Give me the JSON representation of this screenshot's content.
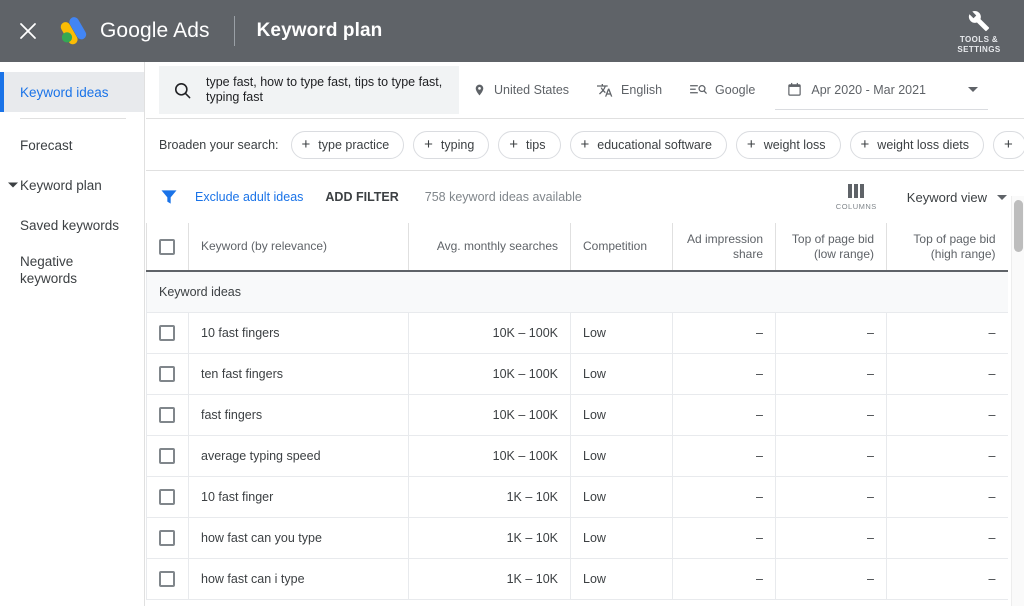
{
  "topbar": {
    "close_icon": "close-icon",
    "logo_icon": "google-ads-logo",
    "brand": "Google Ads",
    "page_title": "Keyword plan",
    "tools_icon": "wrench-icon",
    "tools_label_line1": "TOOLS &",
    "tools_label_line2": "SETTINGS",
    "bg": "#5f6368"
  },
  "sidebar": {
    "items": [
      {
        "label": "Keyword ideas",
        "active": true,
        "expandable": false
      },
      {
        "label": "Forecast",
        "active": false,
        "expandable": false
      },
      {
        "label": "Keyword plan",
        "active": false,
        "expandable": true
      },
      {
        "label": "Saved keywords",
        "active": false,
        "expandable": false
      },
      {
        "label": "Negative keywords",
        "active": false,
        "expandable": false
      }
    ],
    "accent": "#1a73e8"
  },
  "search": {
    "icon": "search-icon",
    "value": "type fast, how to type fast, tips to type fast, typing fast",
    "location_icon": "location-pin-icon",
    "location": "United States",
    "language_icon": "translate-icon",
    "language": "English",
    "network_icon": "search-network-icon",
    "network": "Google",
    "date_icon": "calendar-icon",
    "date_range": "Apr 2020 - Mar 2021",
    "date_caret": "chevron-down-icon"
  },
  "broaden": {
    "label": "Broaden your search:",
    "chips": [
      "type practice",
      "typing",
      "tips",
      "educational software",
      "weight loss",
      "weight loss diets"
    ],
    "partial_chip_plus": "+"
  },
  "toolbar": {
    "filter_icon": "filter-funnel-icon",
    "exclude_adult": "Exclude adult ideas",
    "add_filter": "ADD FILTER",
    "ideas_available": "758 keyword ideas available",
    "columns_icon": "columns-icon",
    "columns_label": "COLUMNS",
    "view_label": "Keyword view",
    "view_caret": "chevron-down-icon"
  },
  "table": {
    "headers": {
      "keyword": "Keyword (by relevance)",
      "avg_monthly": "Avg. monthly searches",
      "competition": "Competition",
      "ad_impression_share_line1": "Ad impression",
      "ad_impression_share_line2": "share",
      "top_bid_low_line1": "Top of page bid",
      "top_bid_low_line2": "(low range)",
      "top_bid_high_line1": "Top of page bid",
      "top_bid_high_line2": "(high range)"
    },
    "group_label": "Keyword ideas",
    "rows": [
      {
        "keyword": "10 fast fingers",
        "avg": "10K – 100K",
        "competition": "Low",
        "ais": "–",
        "bid_low": "–",
        "bid_high": "–"
      },
      {
        "keyword": "ten fast fingers",
        "avg": "10K – 100K",
        "competition": "Low",
        "ais": "–",
        "bid_low": "–",
        "bid_high": "–"
      },
      {
        "keyword": "fast fingers",
        "avg": "10K – 100K",
        "competition": "Low",
        "ais": "–",
        "bid_low": "–",
        "bid_high": "–"
      },
      {
        "keyword": "average typing speed",
        "avg": "10K – 100K",
        "competition": "Low",
        "ais": "–",
        "bid_low": "–",
        "bid_high": "–"
      },
      {
        "keyword": "10 fast finger",
        "avg": "1K – 10K",
        "competition": "Low",
        "ais": "–",
        "bid_low": "–",
        "bid_high": "–"
      },
      {
        "keyword": "how fast can you type",
        "avg": "1K – 10K",
        "competition": "Low",
        "ais": "–",
        "bid_low": "–",
        "bid_high": "–"
      },
      {
        "keyword": "how fast can i type",
        "avg": "1K – 10K",
        "competition": "Low",
        "ais": "–",
        "bid_low": "–",
        "bid_high": "–"
      }
    ]
  }
}
